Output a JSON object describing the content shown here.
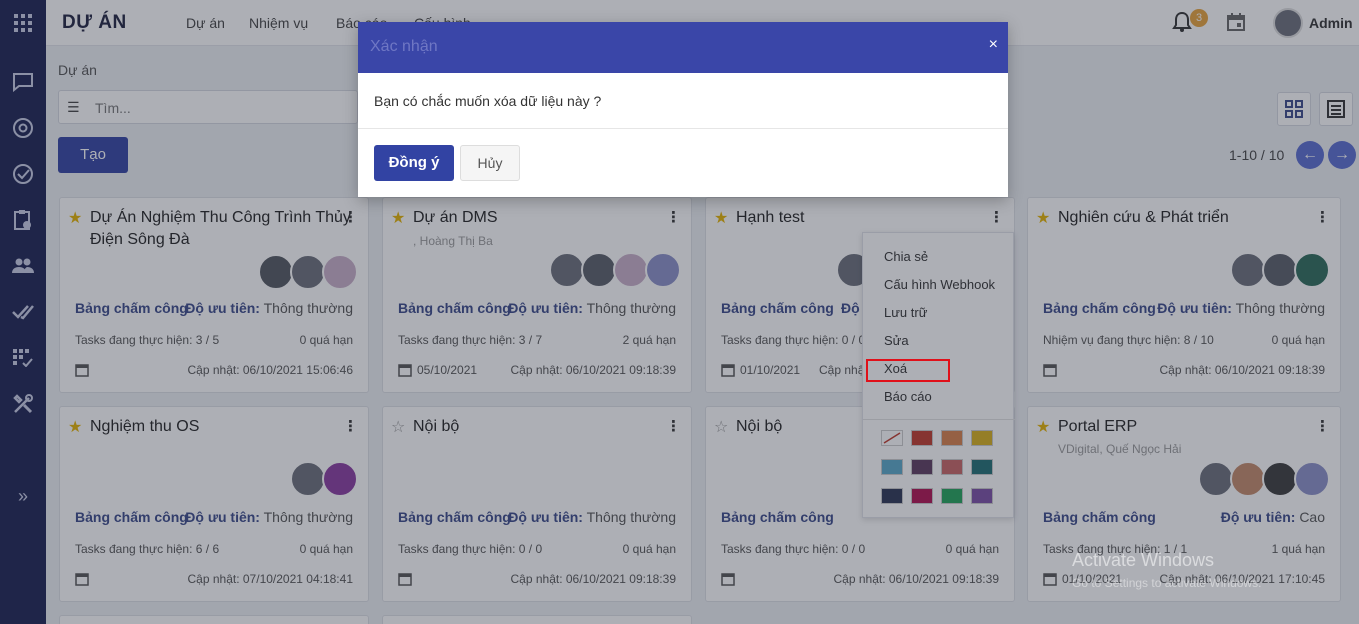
{
  "app": {
    "brand": "DỰ ÁN",
    "admin_name": "Admin",
    "notif_count": "3"
  },
  "topnav": [
    "Dự án",
    "Nhiệm vụ",
    "Báo cáo",
    "Cấu hình"
  ],
  "breadcrumb": "Dự án",
  "search": {
    "placeholder": "Tìm..."
  },
  "create_label": "Tạo",
  "pager": "1-10 / 10",
  "cards": [
    {
      "title": "Dự Án Nghiệm Thu Công Trình Thủy Điện Sông Đà",
      "starred": true,
      "sub": "",
      "bcc": "Bảng chấm công",
      "prio_label": "Độ ưu tiên:",
      "prio_value": "Thông thường",
      "tasks": "Tasks đang thực hiện: 3 / 5",
      "overdue": "0 quá hạn",
      "date": "",
      "updated": "Cập nhật: 06/10/2021 15:06:46"
    },
    {
      "title": "Dự án DMS",
      "starred": true,
      "sub": ", Hoàng Thị Ba",
      "bcc": "Bảng chấm công",
      "prio_label": "Độ ưu tiên:",
      "prio_value": "Thông thường",
      "tasks": "Tasks đang thực hiện: 3 / 7",
      "overdue": "2 quá hạn",
      "date": "05/10/2021",
      "updated": "Cập nhật: 06/10/2021 09:18:39"
    },
    {
      "title": "Hạnh test",
      "starred": true,
      "sub": "",
      "bcc": "Bảng chấm công",
      "prio_label": "Độ ư",
      "prio_value": "",
      "tasks": "Tasks đang thực hiện: 0 / 0",
      "overdue": "",
      "date": "01/10/2021",
      "updated": "Cập nhật"
    },
    {
      "title": "Nghiên cứu & Phát triển",
      "starred": true,
      "sub": "",
      "bcc": "Bảng chấm công",
      "prio_label": "Độ ưu tiên:",
      "prio_value": "Thông thường",
      "tasks": "Nhiệm vụ đang thực hiện: 8 / 10",
      "overdue": "0 quá hạn",
      "date": "",
      "updated": "Cập nhật: 06/10/2021 09:18:39"
    },
    {
      "title": "Nghiệm thu OS",
      "starred": true,
      "sub": "",
      "bcc": "Bảng chấm công",
      "prio_label": "Độ ưu tiên:",
      "prio_value": "Thông thường",
      "tasks": "Tasks đang thực hiện: 6 / 6",
      "overdue": "0 quá hạn",
      "date": "",
      "updated": "Cập nhật: 07/10/2021 04:18:41"
    },
    {
      "title": "Nội bộ",
      "starred": false,
      "sub": "",
      "bcc": "Bảng chấm công",
      "prio_label": "Độ ưu tiên:",
      "prio_value": "Thông thường",
      "tasks": "Tasks đang thực hiện: 0 / 0",
      "overdue": "0 quá hạn",
      "date": "",
      "updated": "Cập nhật: 06/10/2021 09:18:39"
    },
    {
      "title": "Nội bộ",
      "starred": false,
      "sub": "",
      "bcc": "Bảng chấm công",
      "prio_label": "",
      "prio_value": "",
      "tasks": "Tasks đang thực hiện: 0 / 0",
      "overdue": "0 quá hạn",
      "date": "",
      "updated": "Cập nhật: 06/10/2021 09:18:39"
    },
    {
      "title": "Portal ERP",
      "starred": true,
      "sub": "VDigital, Quế Ngọc Hải",
      "bcc": "Bảng chấm công",
      "prio_label": "Độ ưu tiên:",
      "prio_value": "Cao",
      "tasks": "Tasks đang thực hiện: 1 / 1",
      "overdue": "1 quá hạn",
      "date": "01/10/2021",
      "updated": "Cập nhật: 06/10/2021 17:10:45"
    }
  ],
  "dropdown": {
    "items": [
      "Chia sẻ",
      "Cấu hình Webhook",
      "Lưu trữ",
      "Sửa",
      "Xoá",
      "Báo cáo"
    ],
    "colors": [
      "#ffffff",
      "#c0392b",
      "#d9804a",
      "#d8b01a",
      "#5aa8c8",
      "#5c3a5e",
      "#c86464",
      "#1f6f73",
      "#2a3553",
      "#b01050",
      "#21a35a",
      "#7b4ea5"
    ]
  },
  "modal": {
    "title": "Xác nhận",
    "close": "×",
    "body": "Bạn có chắc muốn xóa dữ liệu này ?",
    "ok": "Đồng ý",
    "cancel": "Hủy"
  },
  "watermark": {
    "line1": "Activate Windows",
    "line2": "Go to Settings to activate Windows."
  }
}
